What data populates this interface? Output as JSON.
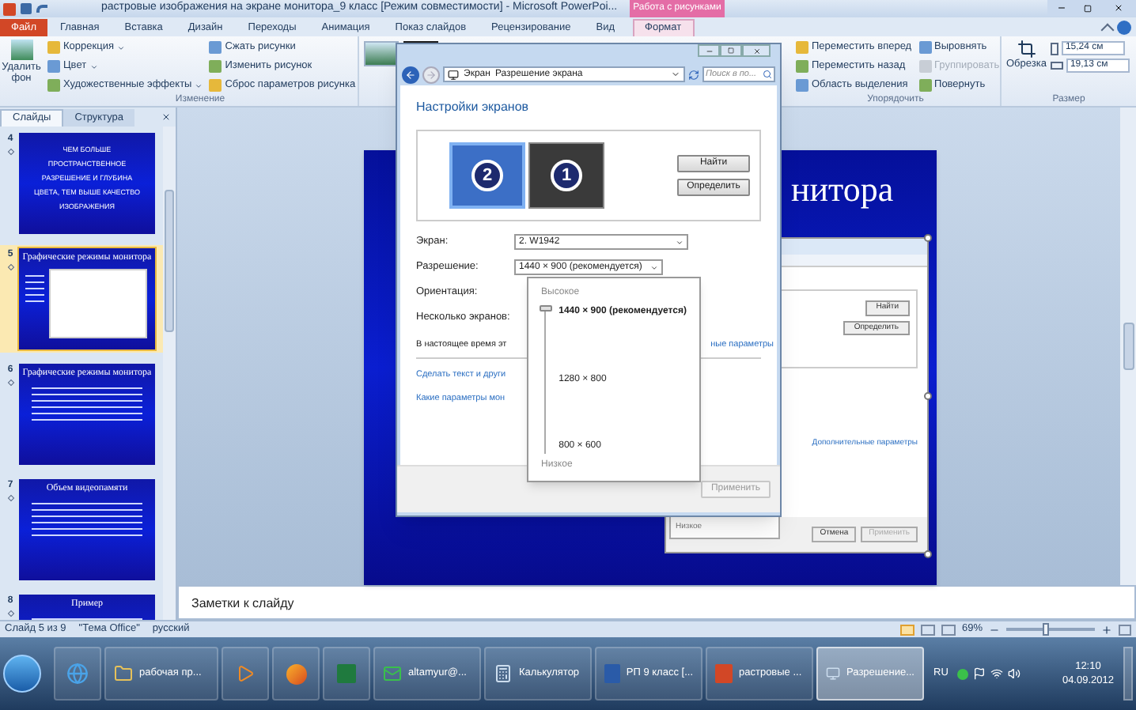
{
  "window": {
    "title": "растровые изображения на экране монитора_9 класс [Режим совместимости] - Microsoft PowerPoi...",
    "context_group": "Работа с рисунками"
  },
  "ribbon_tabs": [
    {
      "label": "Файл",
      "selected": false,
      "kind": "file"
    },
    {
      "label": "Главная",
      "selected": false,
      "kind": "normal"
    },
    {
      "label": "Вставка",
      "selected": false,
      "kind": "normal"
    },
    {
      "label": "Дизайн",
      "selected": false,
      "kind": "normal"
    },
    {
      "label": "Переходы",
      "selected": false,
      "kind": "normal"
    },
    {
      "label": "Анимация",
      "selected": false,
      "kind": "normal"
    },
    {
      "label": "Показ слайдов",
      "selected": false,
      "kind": "normal"
    },
    {
      "label": "Рецензирование",
      "selected": false,
      "kind": "normal"
    },
    {
      "label": "Вид",
      "selected": false,
      "kind": "normal"
    },
    {
      "label": "Формат",
      "selected": true,
      "kind": "context"
    }
  ],
  "ribbon": {
    "remove_background": "Удалить фон",
    "adjust": {
      "label": "Изменение",
      "left": [
        "Коррекция",
        "Цвет",
        "Художественные эффекты"
      ],
      "right": [
        "Сжать рисунки",
        "Изменить рисунок",
        "Сброс параметров рисунка"
      ]
    },
    "arrange": {
      "label": "Упорядочить",
      "items": [
        {
          "label": "Переместить вперед",
          "disabled": false
        },
        {
          "label": "Выровнять",
          "disabled": false
        },
        {
          "label": "Переместить назад",
          "disabled": false
        },
        {
          "label": "Группировать",
          "disabled": true
        },
        {
          "label": "Область выделения",
          "disabled": false
        },
        {
          "label": "Повернуть",
          "disabled": false
        }
      ]
    },
    "size": {
      "label": "Размер",
      "crop": "Обрезка",
      "height": "15,24 см",
      "width": "19,13 см"
    }
  },
  "slides_panel": {
    "tabs": [
      {
        "label": "Слайды",
        "selected": true
      },
      {
        "label": "Структура",
        "selected": false
      }
    ],
    "slides": [
      {
        "number": "4",
        "title": "ЧЕМ БОЛЬШЕ ПРОСТРАНСТВЕННОЕ РАЗРЕШЕНИЕ И ГЛУБИНА ЦВЕТА, ТЕМ ВЫШЕ КАЧЕСТВО ИЗОБРАЖЕНИЯ",
        "selected": false,
        "kind": "caps"
      },
      {
        "number": "5",
        "title": "Графические режимы монитора",
        "selected": true,
        "kind": "screenshot"
      },
      {
        "number": "6",
        "title": "Графические режимы монитора",
        "selected": false,
        "kind": "bullets"
      },
      {
        "number": "7",
        "title": "Объем видеопамяти",
        "selected": false,
        "kind": "bullets"
      },
      {
        "number": "8",
        "title": "Пример",
        "selected": false,
        "kind": "bullets"
      }
    ]
  },
  "slide": {
    "title": "нитора",
    "inset": {
      "buttons": [
        "Найти",
        "Определить"
      ],
      "link": "Дополнительные параметры",
      "low": "Низкое",
      "footer_buttons": [
        {
          "label": "Отмена",
          "disabled": false
        },
        {
          "label": "Применить",
          "disabled": true
        }
      ]
    }
  },
  "notes": {
    "placeholder": "Заметки к слайду"
  },
  "status_bar": {
    "slide": "Слайд 5 из 9",
    "theme": "\"Тема Office\"",
    "language": "русский",
    "zoom": "69%",
    "zoom_slider": {
      "level": 0.45
    }
  },
  "dialog": {
    "breadcrumb": [
      "Экран",
      "Разрешение экрана"
    ],
    "search": {
      "placeholder": "Поиск в по..."
    },
    "heading": "Настройки экранов",
    "monitors": [
      {
        "label": "2",
        "selected": true
      },
      {
        "label": "1",
        "selected": false
      }
    ],
    "buttons": [
      "Найти",
      "Определить"
    ],
    "fields": [
      {
        "label": "Экран:",
        "value": "2. W1942",
        "kind": "select"
      },
      {
        "label": "Разрешение:",
        "value": "1440 × 900 (рекомендуется)",
        "kind": "select"
      },
      {
        "label": "Ориентация:",
        "kind": "label"
      },
      {
        "label": "Несколько экранов:",
        "kind": "label"
      }
    ],
    "notice": "В настоящее время эт",
    "advanced_link": "ные параметры",
    "links": [
      "Сделать текст и други",
      "Какие параметры мон"
    ],
    "apply": {
      "label": "Применить",
      "disabled": true
    },
    "resolution_menu": {
      "high": "Высокое",
      "low": "Низкое",
      "level": 1,
      "options": [
        {
          "label": "1440 × 900 (рекомендуется)",
          "selected": true
        },
        {
          "label": "1280 × 800",
          "selected": false
        },
        {
          "label": "800 × 600",
          "selected": false
        }
      ]
    }
  },
  "taskbar": {
    "items": [
      {
        "kind": "browser"
      },
      {
        "kind": "folder",
        "label": "рабочая пр...",
        "active": false
      },
      {
        "kind": "media"
      },
      {
        "kind": "firefox"
      },
      {
        "kind": "excel"
      },
      {
        "kind": "mail",
        "label": "altamyur@...",
        "active": false
      },
      {
        "kind": "calculator",
        "label": "Калькулятор",
        "active": false
      },
      {
        "kind": "word",
        "label": "РП 9 класс [...",
        "active": false
      },
      {
        "kind": "powerpoint",
        "label": "растровые ...",
        "active": false
      },
      {
        "kind": "display",
        "label": "Разрешение...",
        "active": true
      }
    ],
    "language": "RU",
    "time": "12:10",
    "date": "04.09.2012"
  }
}
